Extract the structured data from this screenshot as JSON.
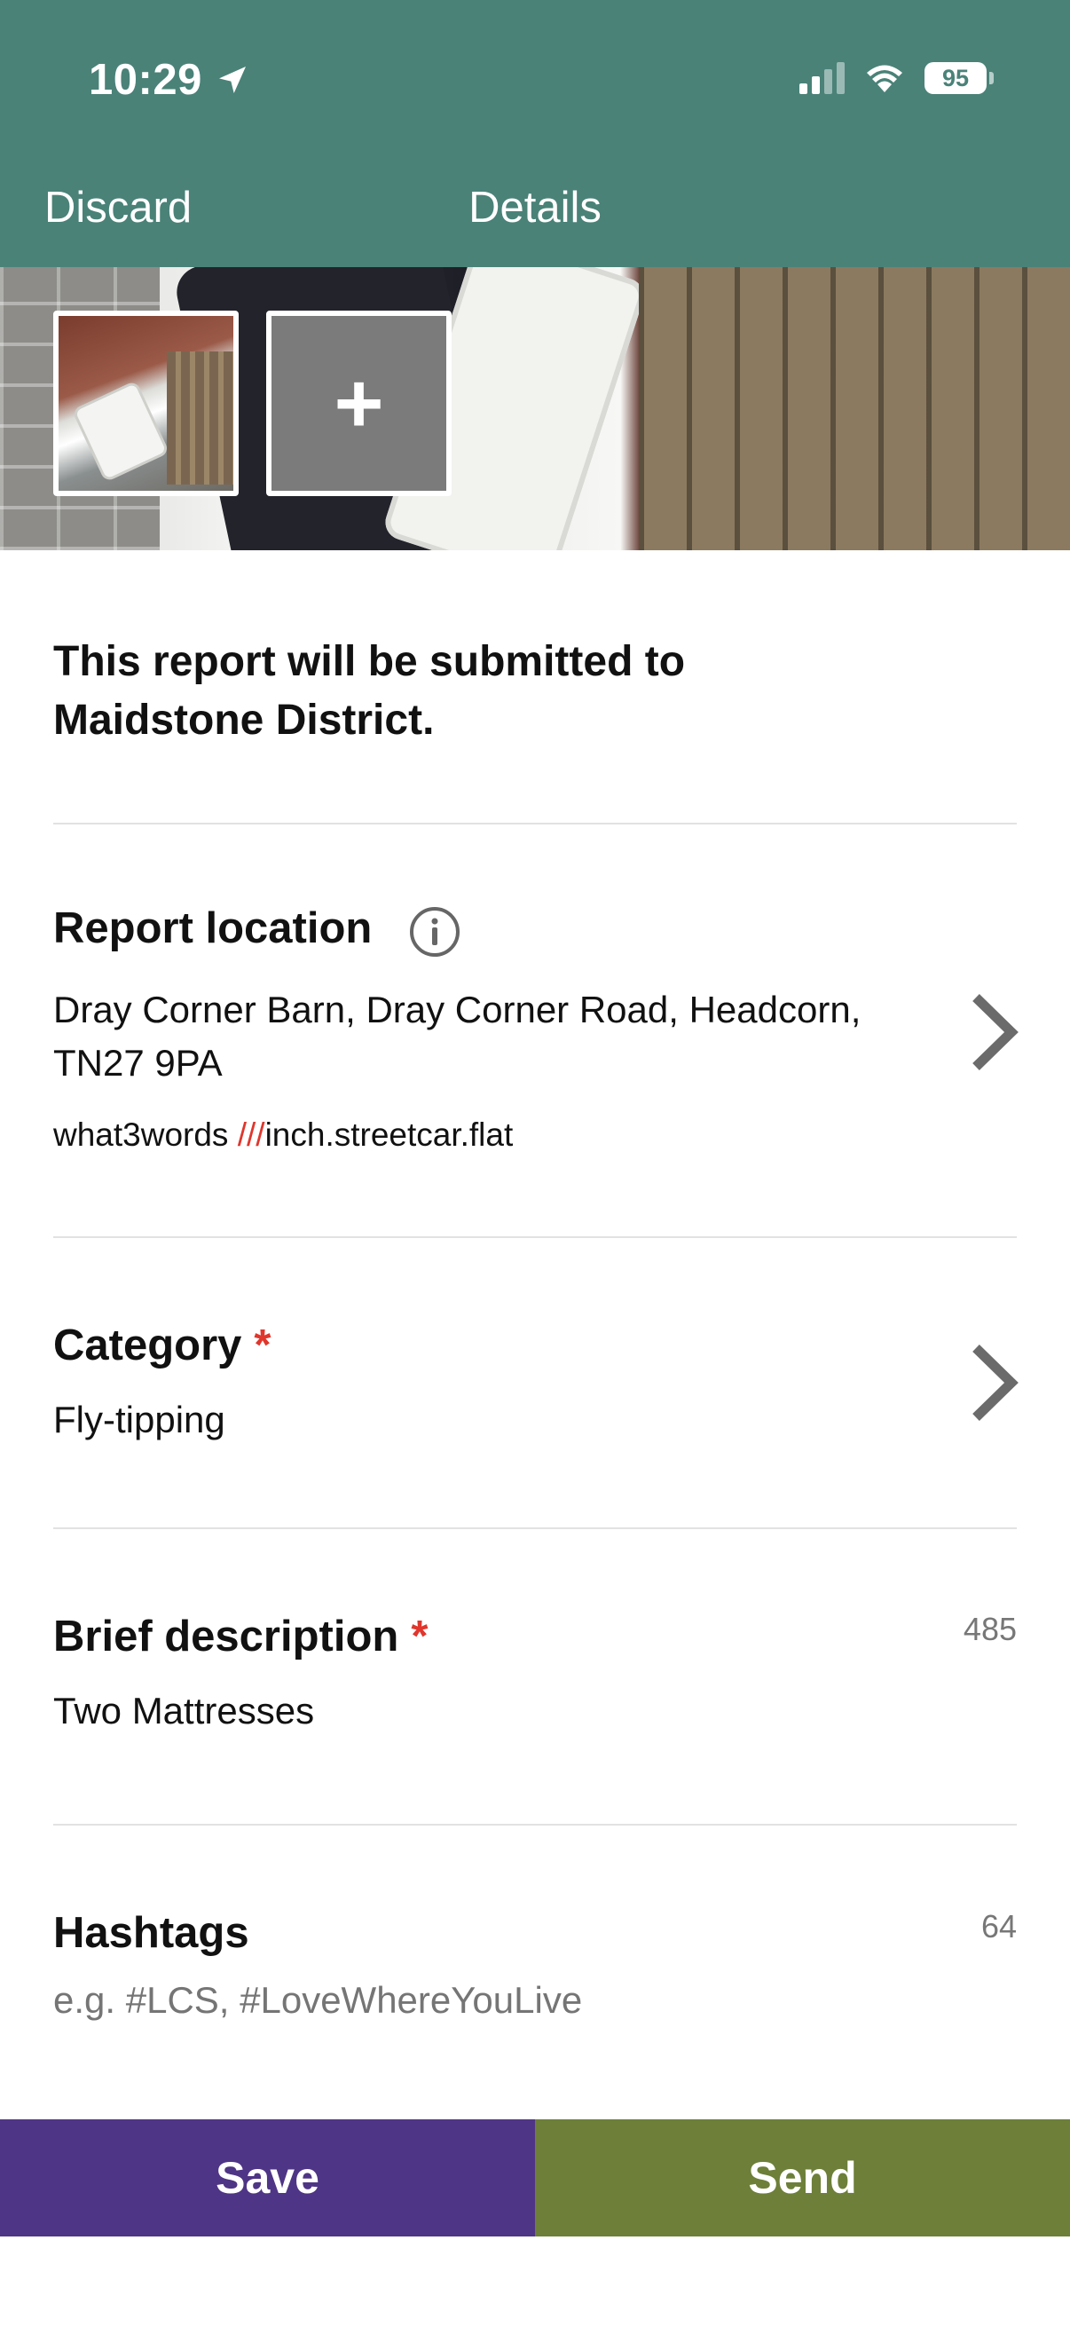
{
  "status_bar": {
    "time": "10:29",
    "battery": "95"
  },
  "nav": {
    "discard_label": "Discard",
    "title": "Details"
  },
  "photos": {
    "add_label": "+"
  },
  "submission": {
    "text": "This report will be submitted to Maidstone District."
  },
  "location": {
    "label": "Report location",
    "address": "Dray Corner Barn, Dray Corner Road, Headcorn, TN27 9PA",
    "w3w_prefix": "what3words",
    "w3w_slashes": "///",
    "w3w_words": "inch.streetcar.flat"
  },
  "category": {
    "label": "Category",
    "required_mark": "*",
    "value": "Fly-tipping"
  },
  "description": {
    "label": "Brief description",
    "required_mark": "*",
    "counter": "485",
    "value": "Two Mattresses"
  },
  "hashtags": {
    "label": "Hashtags",
    "counter": "64",
    "placeholder": "e.g. #LCS, #LoveWhereYouLive"
  },
  "actions": {
    "save_label": "Save",
    "send_label": "Send"
  },
  "colors": {
    "header": "#4a8278",
    "save": "#4f3585",
    "send": "#6d7f39",
    "required": "#e0362c"
  }
}
